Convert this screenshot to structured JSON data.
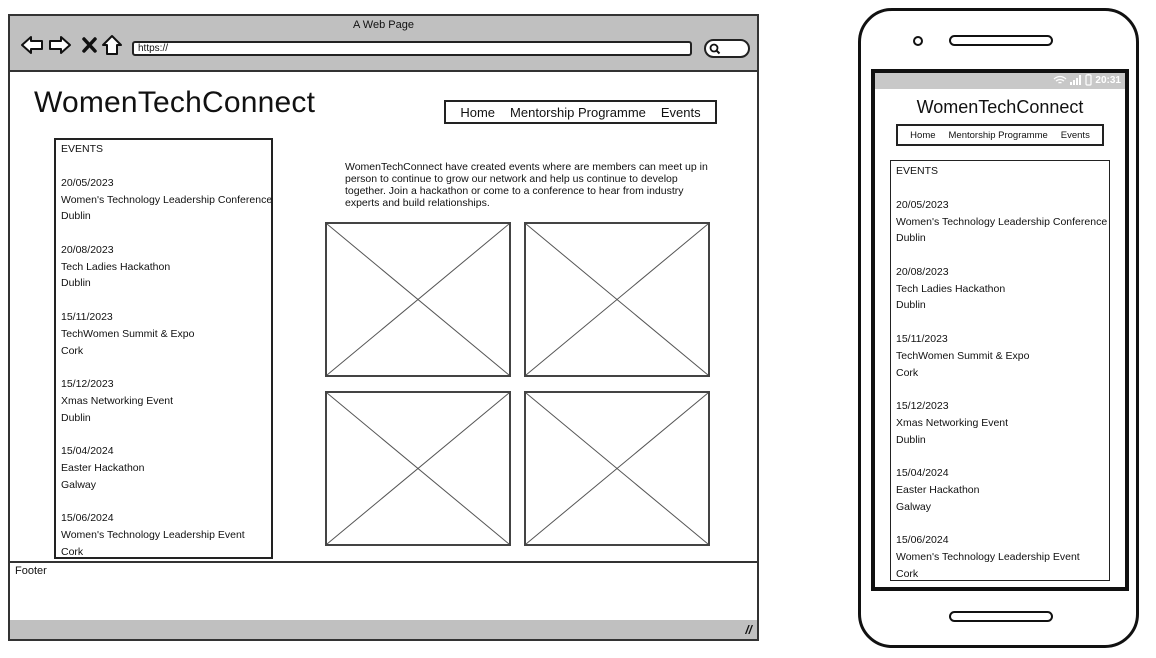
{
  "browser": {
    "window_title": "A Web Page",
    "url": "https://",
    "nav_icons": [
      "back-arrow-icon",
      "forward-arrow-icon",
      "close-x-icon",
      "home-icon"
    ],
    "search_icon": "magnifier-icon"
  },
  "site": {
    "title": "WomenTechConnect",
    "nav": [
      "Home",
      "Mentorship Programme",
      "Events"
    ]
  },
  "events": {
    "heading": "EVENTS",
    "items": [
      {
        "date": "20/05/2023",
        "name": "Women's Technology Leadership Conference",
        "location": "Dublin"
      },
      {
        "date": "20/08/2023",
        "name": "Tech Ladies Hackathon",
        "location": "Dublin"
      },
      {
        "date": "15/11/2023",
        "name": "TechWomen Summit & Expo",
        "location": "Cork"
      },
      {
        "date": "15/12/2023",
        "name": "Xmas Networking Event",
        "location": "Dublin"
      },
      {
        "date": "15/04/2024",
        "name": "Easter Hackathon",
        "location": "Galway"
      },
      {
        "date": "15/06/2024",
        "name": "Women's Technology Leadership Event",
        "location": "Cork"
      }
    ]
  },
  "intro_text": "WomenTechConnect have created events where are members can meet up in person to continue to grow our network and help us continue to develop together. Join a hackathon or come to a conference to hear from industry experts and build relationships.",
  "image_placeholders": 4,
  "footer": {
    "label": "Footer"
  },
  "mobile": {
    "status_time": "20:31",
    "status_icons": [
      "wifi-icon",
      "signal-icon",
      "battery-icon"
    ]
  }
}
